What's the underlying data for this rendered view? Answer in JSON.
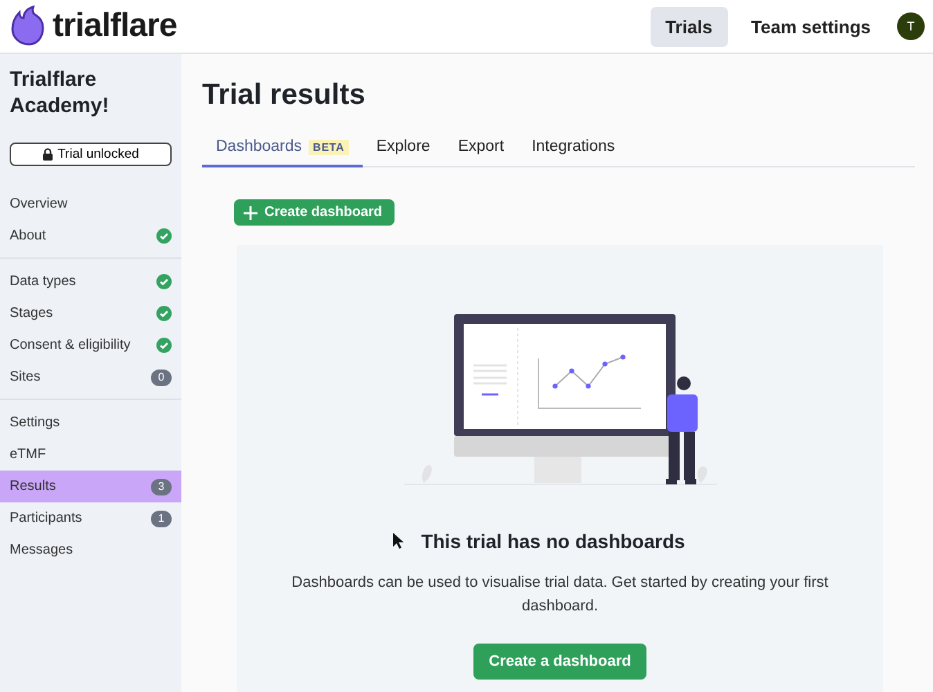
{
  "header": {
    "brand": "trialflare",
    "nav": [
      {
        "label": "Trials",
        "selected": true
      },
      {
        "label": "Team settings",
        "selected": false
      }
    ],
    "avatar": "T"
  },
  "sidebar": {
    "title": "Trialflare Academy!",
    "unlock_button": "Trial unlocked",
    "sections": [
      {
        "items": [
          {
            "label": "Overview",
            "kind": "plain",
            "selected": false
          },
          {
            "label": "About",
            "kind": "check",
            "selected": false
          }
        ]
      },
      {
        "items": [
          {
            "label": "Data types",
            "kind": "check",
            "selected": false
          },
          {
            "label": "Stages",
            "kind": "check",
            "selected": false
          },
          {
            "label": "Consent & eligibility",
            "kind": "check",
            "selected": false
          },
          {
            "label": "Sites",
            "kind": "count",
            "count": "0",
            "selected": false
          }
        ]
      },
      {
        "items": [
          {
            "label": "Settings",
            "kind": "plain",
            "selected": false
          },
          {
            "label": "eTMF",
            "kind": "plain",
            "selected": false
          },
          {
            "label": "Results",
            "kind": "count",
            "count": "3",
            "selected": true
          },
          {
            "label": "Participants",
            "kind": "count",
            "count": "1",
            "selected": false
          },
          {
            "label": "Messages",
            "kind": "plain",
            "selected": false
          }
        ]
      }
    ]
  },
  "page": {
    "title": "Trial results",
    "tabs": [
      {
        "label": "Dashboards",
        "badge": "BETA",
        "selected": true
      },
      {
        "label": "Explore",
        "selected": false
      },
      {
        "label": "Export",
        "selected": false
      },
      {
        "label": "Integrations",
        "selected": false
      }
    ],
    "create_button": "Create dashboard",
    "empty_state": {
      "heading": "This trial has no dashboards",
      "text": "Dashboards can be used to visualise trial data. Get started by creating your first dashboard.",
      "button": "Create a dashboard"
    }
  }
}
